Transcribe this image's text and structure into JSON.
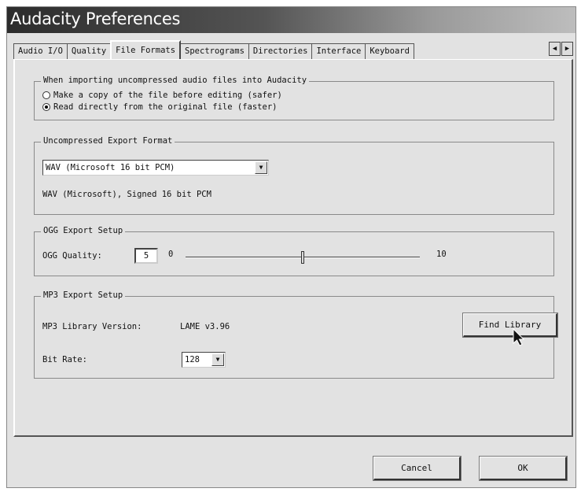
{
  "window": {
    "title": "Audacity Preferences"
  },
  "tabs": [
    {
      "label": "Audio I/O"
    },
    {
      "label": "Quality"
    },
    {
      "label": "File Formats"
    },
    {
      "label": "Spectrograms"
    },
    {
      "label": "Directories"
    },
    {
      "label": "Interface"
    },
    {
      "label": "Keyboard"
    }
  ],
  "tab_scroll": {
    "left_icon": "arrow-left-icon",
    "right_icon": "arrow-right-icon"
  },
  "import_group": {
    "title": "When importing uncompressed audio files into Audacity",
    "options": [
      {
        "label": "Make a copy of the file before editing (safer)",
        "selected": false
      },
      {
        "label": "Read directly from the original file (faster)",
        "selected": true
      }
    ]
  },
  "export_format": {
    "title": "Uncompressed Export Format",
    "selected": "WAV (Microsoft 16 bit PCM)",
    "description": "WAV (Microsoft), Signed 16 bit PCM"
  },
  "ogg": {
    "title": "OGG Export Setup",
    "quality_label": "OGG Quality:",
    "quality_value": "5",
    "min_label": "0",
    "max_label": "10",
    "slider_value": 5
  },
  "mp3": {
    "title": "MP3 Export Setup",
    "library_label": "MP3 Library Version:",
    "library_version": "LAME v3.96",
    "find_library_button": "Find Library",
    "bitrate_label": "Bit Rate:",
    "bitrate_value": "128"
  },
  "footer": {
    "cancel": "Cancel",
    "ok": "OK"
  }
}
